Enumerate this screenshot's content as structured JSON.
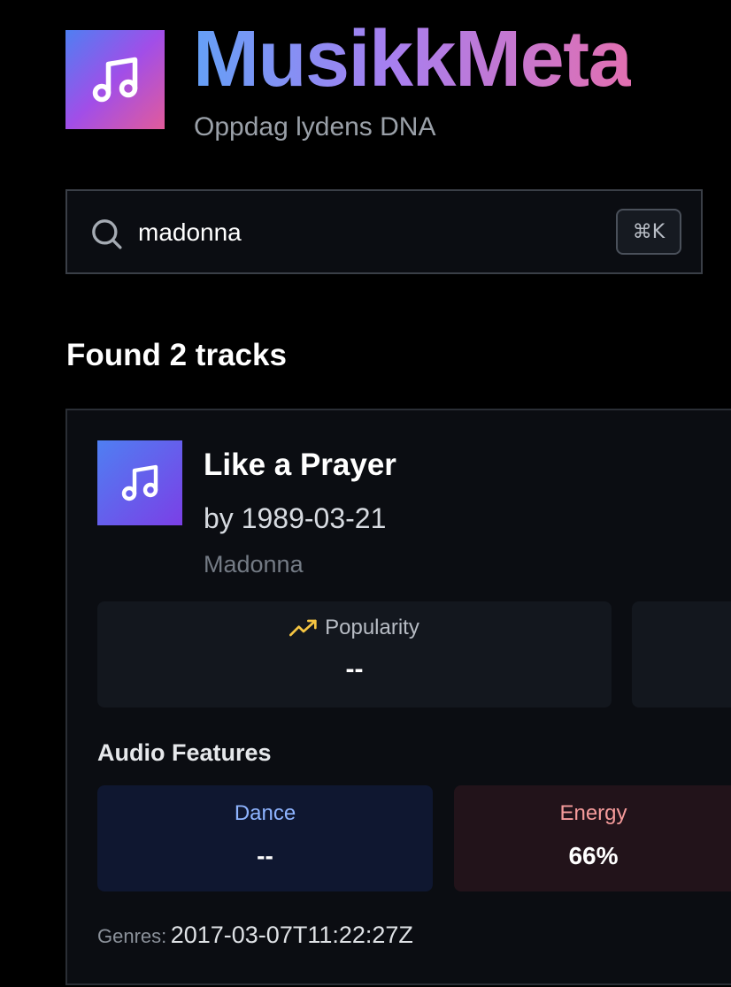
{
  "header": {
    "title": "MusikkMeta",
    "subtitle": "Oppdag lydens DNA",
    "logo_icon": "music-note-icon"
  },
  "search": {
    "value": "madonna",
    "placeholder": "",
    "shortcut": "⌘K"
  },
  "results": {
    "summary": "Found 2 tracks",
    "tracks": [
      {
        "title": "Like a Prayer",
        "byline": "by 1989-03-21",
        "artist": "Madonna",
        "stats": {
          "popularity_label": "Popularity",
          "popularity_value": "--"
        },
        "audio_features": {
          "section_title": "Audio Features",
          "dance_label": "Dance",
          "dance_value": "--",
          "energy_label": "Energy",
          "energy_value": "66%"
        },
        "genres_label": "Genres:",
        "genres_value": "2017-03-07T11:22:27Z"
      }
    ]
  },
  "colors": {
    "background": "#000000",
    "accent_blue": "#64a0f7",
    "accent_purple": "#a77ff0",
    "accent_pink": "#e26fb0",
    "popularity_icon": "#f5c542",
    "dance": "#8eb4ff",
    "energy": "#f59b9b"
  }
}
